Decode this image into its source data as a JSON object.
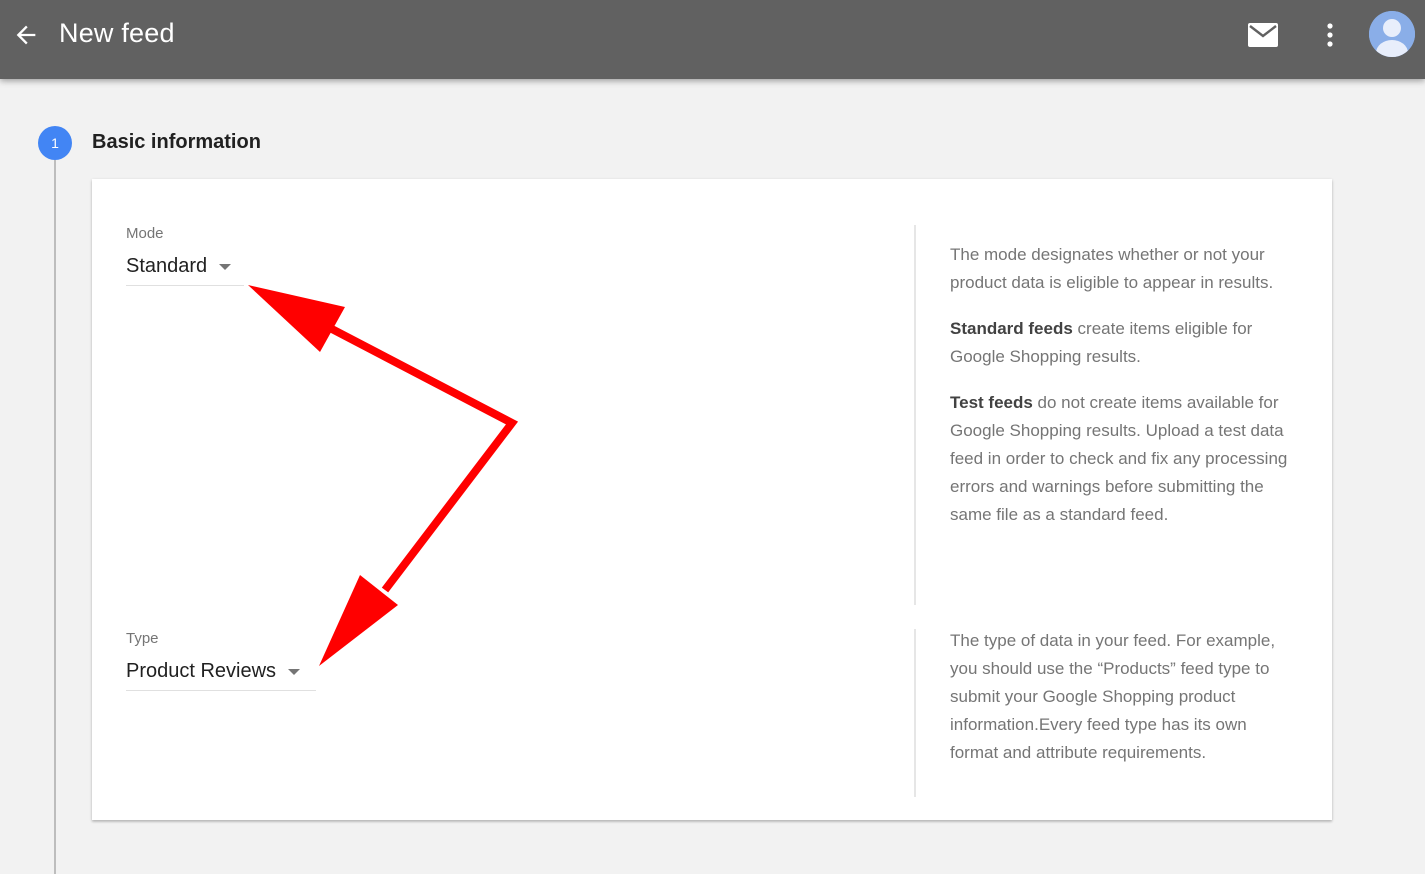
{
  "header": {
    "title": "New feed",
    "back_icon": "arrow-back-icon",
    "mail_icon": "mail-icon",
    "more_icon": "more-vert-icon",
    "avatar_icon": "account-avatar-icon"
  },
  "step": {
    "number": "1",
    "title": "Basic information"
  },
  "mode": {
    "label": "Mode",
    "value": "Standard",
    "help_para1": "The mode designates whether or not your product data is eligible to appear in results.",
    "help_para2_bold": "Standard feeds",
    "help_para2_rest": " create items eligible for Google Shopping results.",
    "help_para3_bold": "Test feeds",
    "help_para3_rest": " do not create items available for Google Shopping results. Upload a test data feed in order to check and fix any processing errors and warnings before submitting the same file as a standard feed."
  },
  "type": {
    "label": "Type",
    "value": "Product Reviews",
    "help_para1": "The type of data in your feed. For example, you should use the “Products” feed type to submit your Google Shopping product information.Every feed type has its own format and attribute requirements."
  },
  "colors": {
    "topbar": "#616161",
    "step_badge": "#4285f4",
    "annotation_arrow": "#ff0000"
  }
}
